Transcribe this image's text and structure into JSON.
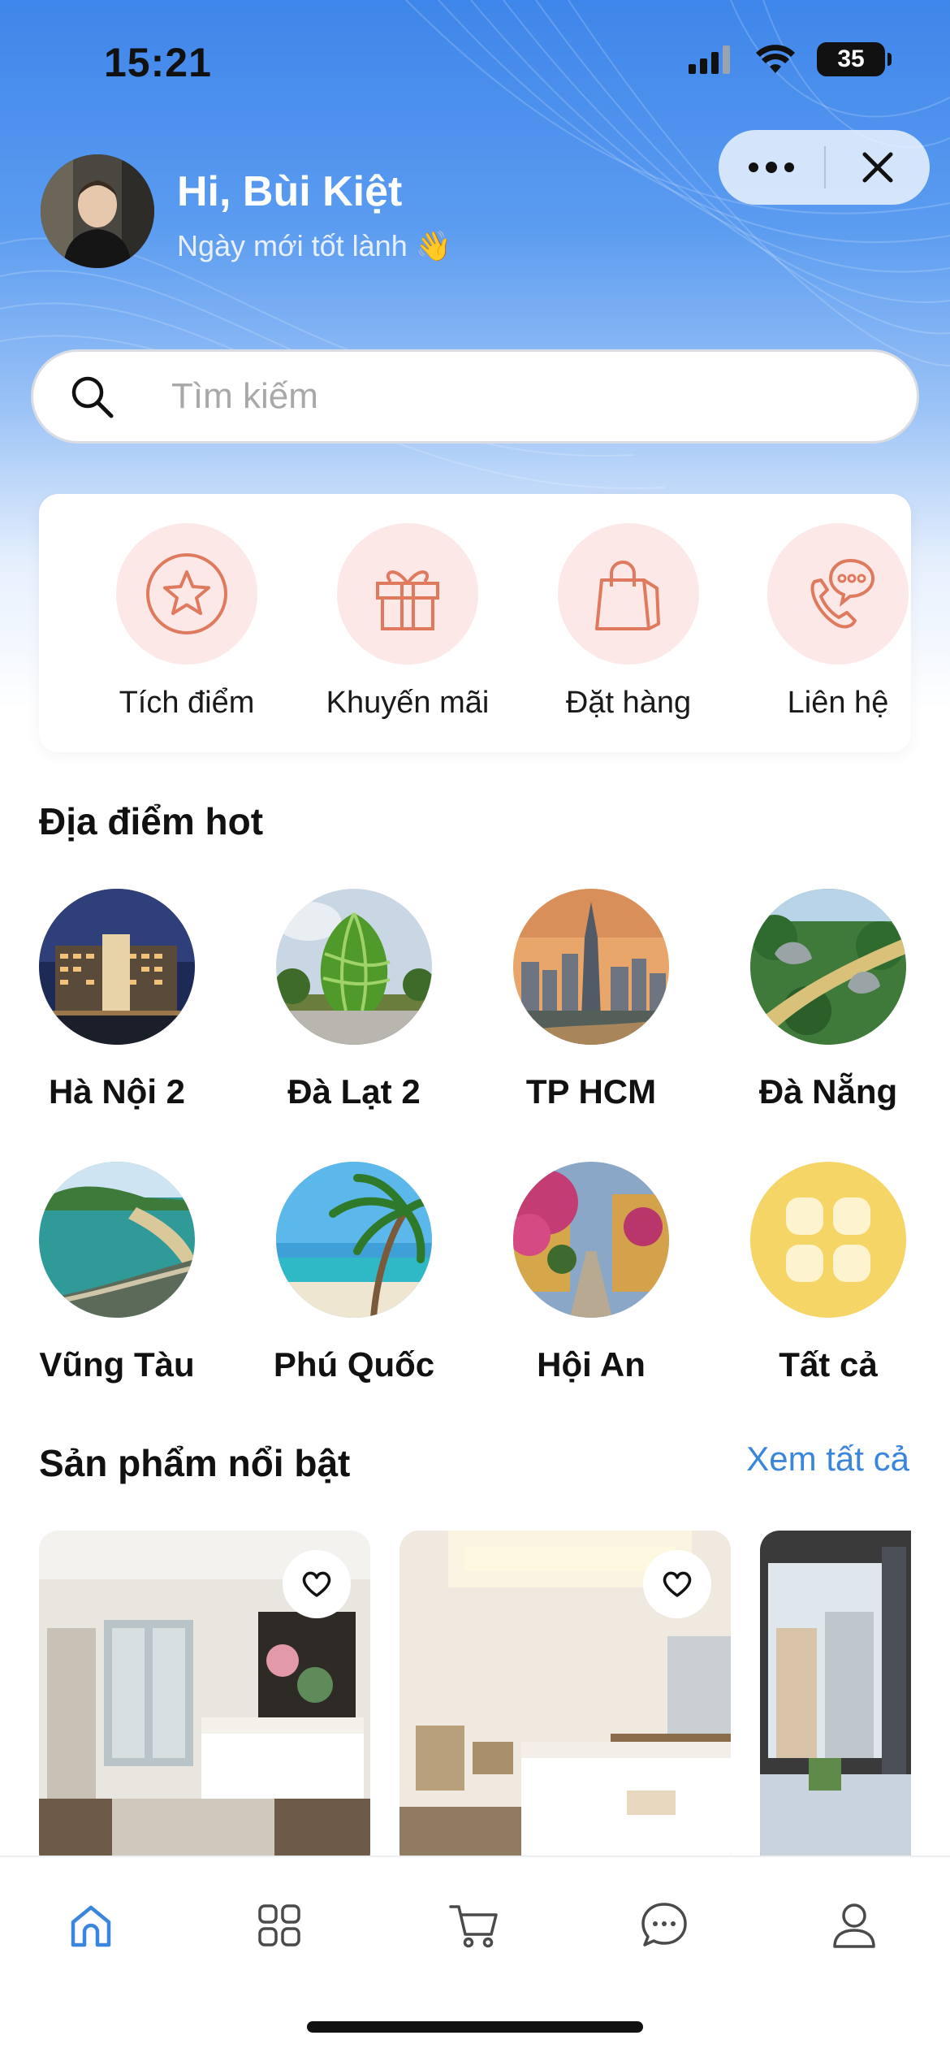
{
  "status_bar": {
    "time": "15:21",
    "battery": "35"
  },
  "header": {
    "greeting": "Hi, Bùi Kiệt",
    "subtitle": "Ngày mới tốt lành 👋"
  },
  "search": {
    "placeholder": "Tìm kiếm"
  },
  "quick_actions": [
    {
      "label": "Tích điểm",
      "icon": "star-badge-icon"
    },
    {
      "label": "Khuyến mãi",
      "icon": "gift-icon"
    },
    {
      "label": "Đặt hàng",
      "icon": "shopping-bag-icon"
    },
    {
      "label": "Liên hệ",
      "icon": "phone-chat-icon"
    }
  ],
  "hot_places": {
    "title": "Địa điểm hot",
    "items": [
      {
        "label": "Hà Nội 2"
      },
      {
        "label": "Đà Lạt 2"
      },
      {
        "label": "TP HCM"
      },
      {
        "label": "Đà Nẵng"
      },
      {
        "label": "Vũng Tàu"
      },
      {
        "label": "Phú Quốc"
      },
      {
        "label": "Hội An"
      },
      {
        "label": "Tất cả"
      }
    ]
  },
  "featured": {
    "title": "Sản phẩm nổi bật",
    "see_all": "Xem tất cả"
  },
  "tabbar": [
    {
      "icon": "home-icon",
      "active": true
    },
    {
      "icon": "grid-icon",
      "active": false
    },
    {
      "icon": "cart-icon",
      "active": false
    },
    {
      "icon": "chat-icon",
      "active": false
    },
    {
      "icon": "profile-icon",
      "active": false
    }
  ],
  "colors": {
    "accent": "#3a86dc",
    "action_bg": "#fbe8e7",
    "action_icon": "#e07a5f"
  }
}
